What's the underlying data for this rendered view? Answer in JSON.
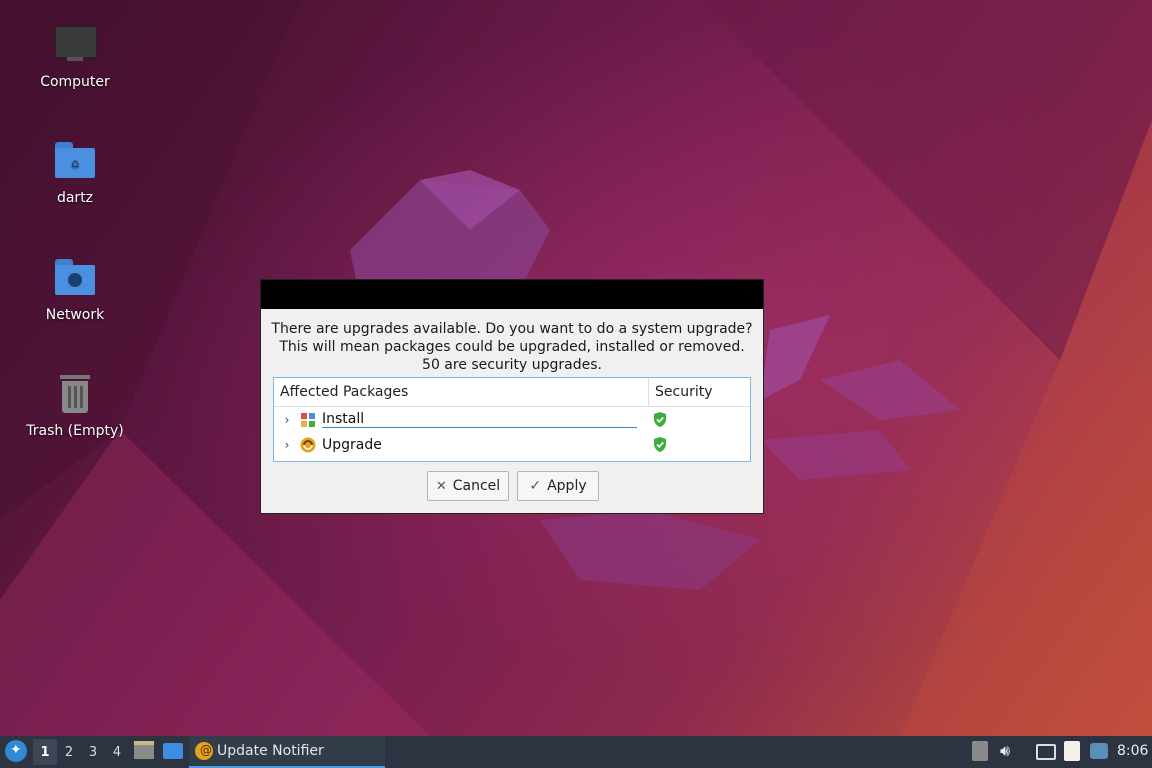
{
  "desktop": {
    "icons": [
      {
        "label": "Computer"
      },
      {
        "label": "dartz"
      },
      {
        "label": "Network"
      },
      {
        "label": "Trash (Empty)"
      }
    ]
  },
  "dialog": {
    "message_lines": [
      "There are upgrades available. Do you want to do a system upgrade?",
      "This will mean packages could be upgraded, installed or removed.",
      "50 are security upgrades."
    ],
    "columns": [
      "Affected Packages",
      "Security"
    ],
    "rows": [
      {
        "label": "Install",
        "icon": "install-icon",
        "security": "shield-check-icon"
      },
      {
        "label": "Upgrade",
        "icon": "upgrade-icon",
        "security": "shield-check-icon"
      }
    ],
    "cancel_label": "Cancel",
    "apply_label": "Apply"
  },
  "taskbar": {
    "workspaces": [
      "1",
      "2",
      "3",
      "4"
    ],
    "active_workspace": "1",
    "task_label": "Update Notifier",
    "clock": "8:06"
  },
  "colors": {
    "accent": "#3a87c4",
    "shield": "#3cae3c",
    "taskbar": "#2b3440"
  }
}
